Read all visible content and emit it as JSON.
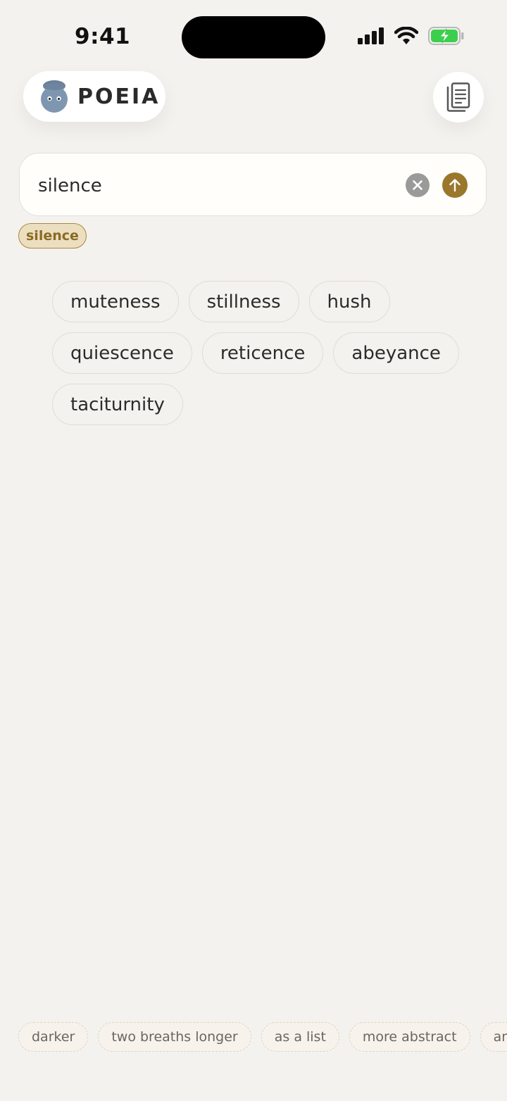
{
  "status_bar": {
    "time": "9:41"
  },
  "header": {
    "brand_name": "POEIA",
    "journal_icon": "journal-icon"
  },
  "search": {
    "value": "silence",
    "placeholder": "",
    "clear_icon": "close-icon",
    "submit_icon": "arrow-up-icon"
  },
  "query_tag": "silence",
  "results": {
    "rows": [
      [
        "muteness",
        "stillness",
        "hush"
      ],
      [
        "quiescence",
        "reticence",
        "abeyance"
      ],
      [
        "taciturnity"
      ]
    ]
  },
  "suggestions": [
    "darker",
    "two breaths longer",
    "as a list",
    "more abstract",
    "an"
  ],
  "colors": {
    "background": "#f4f2ee",
    "accent": "#9a772b",
    "tag_fill": "#ecdfc0",
    "battery_green": "#3ccf4e"
  }
}
